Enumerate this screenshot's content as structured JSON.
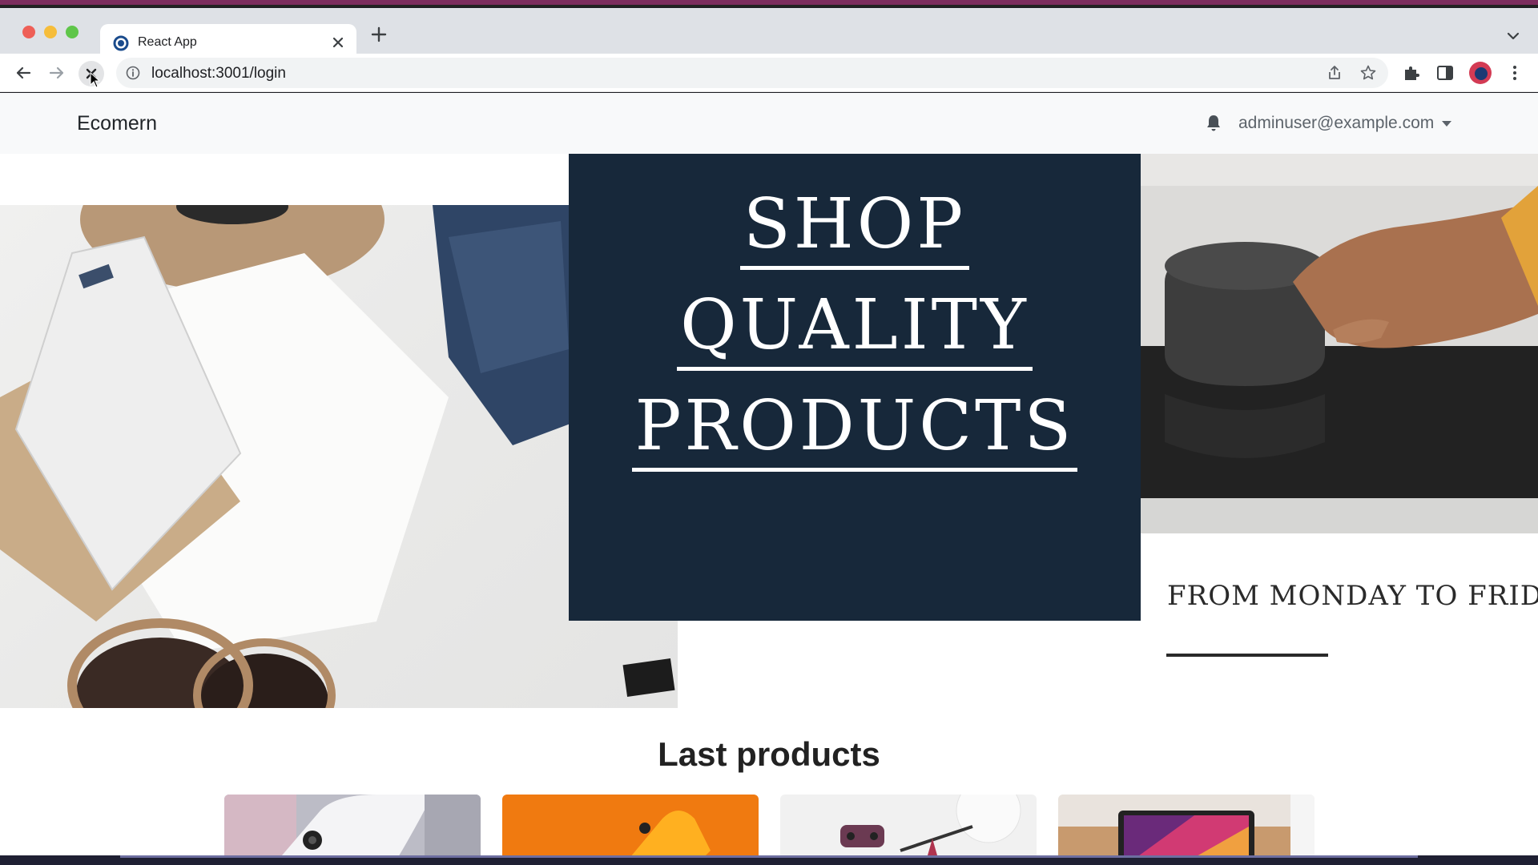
{
  "browser": {
    "tab": {
      "title": "React App"
    },
    "address": {
      "url": "localhost:3001/login"
    }
  },
  "app": {
    "brand": "Ecomern",
    "user": {
      "email": "adminuser@example.com"
    }
  },
  "hero": {
    "headline": [
      "SHOP",
      "QUALITY",
      "PRODUCTS"
    ],
    "promo": "FROM MONDAY TO FRID"
  },
  "products": {
    "title": "Last products",
    "cards": [
      {
        "image": "iphone-white"
      },
      {
        "image": "iphone-orange"
      },
      {
        "image": "drone"
      },
      {
        "image": "macbook"
      }
    ]
  },
  "colors": {
    "hero_panel": "#17283a",
    "navbar_bg": "#f8f9fa"
  }
}
